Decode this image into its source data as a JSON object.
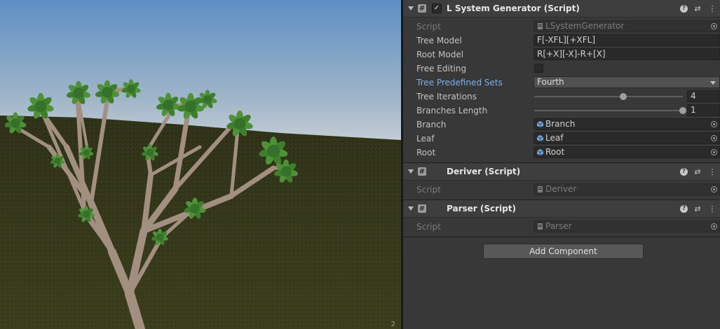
{
  "scene": {
    "status_text": "2",
    "colors": {
      "sky_top": "#5d8fc4",
      "sky_horizon": "#c2ccd4",
      "ground": "#3a3d1e",
      "branch": "#a38f80",
      "leaf": "#3f7f2c"
    }
  },
  "inspector": {
    "components": [
      {
        "title": "L System Generator (Script)",
        "enabled": true,
        "script_label": "Script",
        "script_value": "LSystemGenerator",
        "properties": {
          "tree_model": {
            "label": "Tree Model",
            "value": "F[-XFL][+XFL]"
          },
          "root_model": {
            "label": "Root Model",
            "value": "R[+X][-X]-R+[X]"
          },
          "free_editing": {
            "label": "Free Editing",
            "checked": false
          },
          "tree_predefined_sets": {
            "label": "Tree Predefined Sets",
            "value": "Fourth"
          },
          "tree_iterations": {
            "label": "Tree Iterations",
            "value": "4",
            "fraction": 0.6
          },
          "branches_length": {
            "label": "Branches Length",
            "value": "1",
            "fraction": 1.0
          },
          "branch": {
            "label": "Branch",
            "value": "Branch"
          },
          "leaf": {
            "label": "Leaf",
            "value": "Leaf"
          },
          "root": {
            "label": "Root",
            "value": "Root"
          }
        }
      },
      {
        "title": "Deriver (Script)",
        "script_label": "Script",
        "script_value": "Deriver"
      },
      {
        "title": "Parser (Script)",
        "script_label": "Script",
        "script_value": "Parser"
      }
    ],
    "add_component_label": "Add Component"
  }
}
